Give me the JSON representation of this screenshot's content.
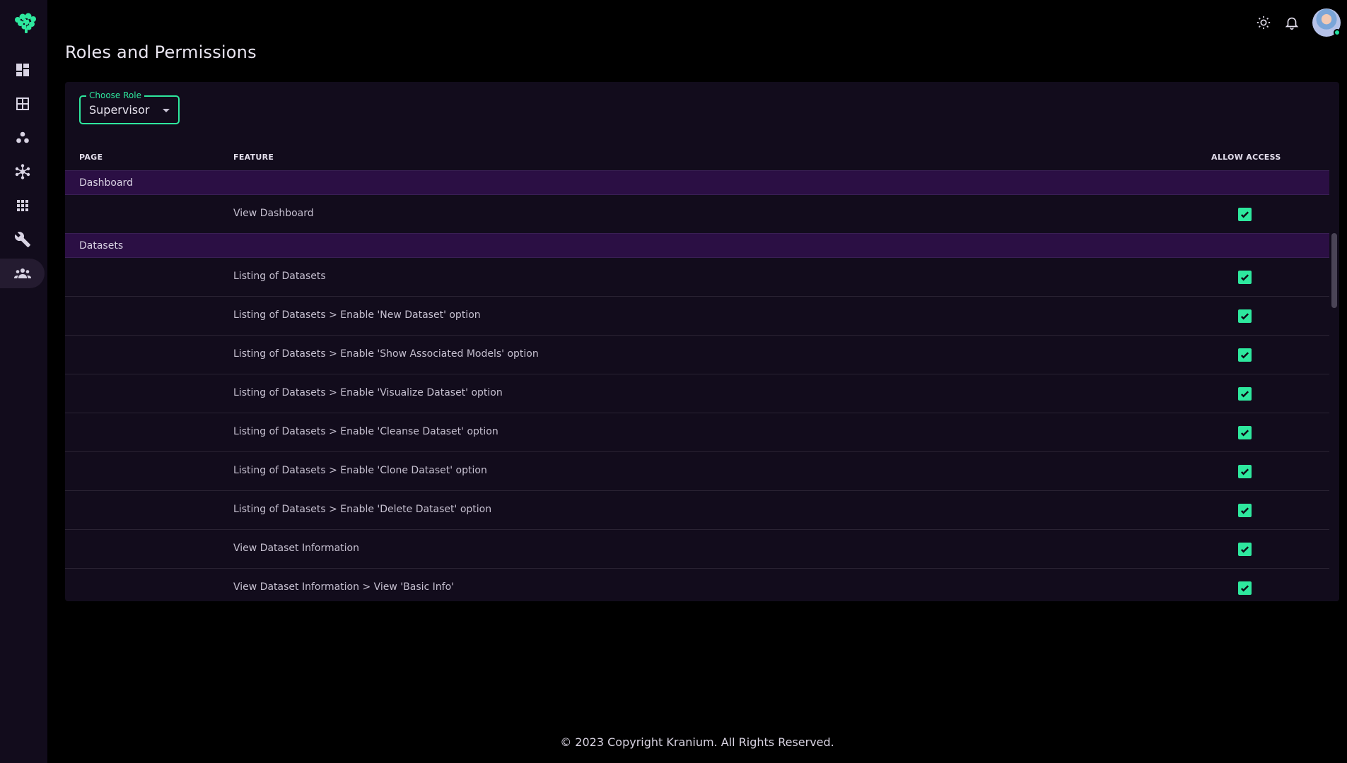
{
  "page": {
    "title": "Roles and Permissions"
  },
  "sidebar": {
    "logo": "kranium-logo-icon",
    "items": [
      {
        "name": "dashboard",
        "icon": "dashboard-icon"
      },
      {
        "name": "datasets",
        "icon": "grid-box-icon"
      },
      {
        "name": "models",
        "icon": "three-dots-icon"
      },
      {
        "name": "network",
        "icon": "hub-icon"
      },
      {
        "name": "apps",
        "icon": "apps-grid-icon"
      },
      {
        "name": "tools",
        "icon": "wrench-icon"
      },
      {
        "name": "users",
        "icon": "group-icon",
        "active": true
      }
    ]
  },
  "topbar": {
    "theme_icon": "sun-icon",
    "notifications_icon": "bell-icon",
    "avatar": "user-avatar"
  },
  "role_select": {
    "legend": "Choose Role",
    "value": "Supervisor"
  },
  "table": {
    "headers": {
      "page": "PAGE",
      "feature": "FEATURE",
      "allow": "ALLOW ACCESS"
    },
    "groups": [
      {
        "page": "Dashboard",
        "features": [
          {
            "label": "View Dashboard",
            "allowed": true
          }
        ]
      },
      {
        "page": "Datasets",
        "features": [
          {
            "label": "Listing of Datasets",
            "allowed": true
          },
          {
            "label": "Listing of Datasets > Enable 'New Dataset' option",
            "allowed": true
          },
          {
            "label": "Listing of Datasets > Enable 'Show Associated Models' option",
            "allowed": true
          },
          {
            "label": "Listing of Datasets > Enable 'Visualize Dataset' option",
            "allowed": true
          },
          {
            "label": "Listing of Datasets > Enable 'Cleanse Dataset' option",
            "allowed": true
          },
          {
            "label": "Listing of Datasets > Enable 'Clone Dataset' option",
            "allowed": true
          },
          {
            "label": "Listing of Datasets > Enable 'Delete Dataset' option",
            "allowed": true
          },
          {
            "label": "View Dataset Information",
            "allowed": true
          },
          {
            "label": "View Dataset Information > View 'Basic Info'",
            "allowed": true
          }
        ]
      }
    ]
  },
  "colors": {
    "accent": "#2ee89e",
    "group_row": "#2b0f44",
    "card": "#120c1c"
  },
  "footer": {
    "text": "© 2023 Copyright Kranium. All Rights Reserved."
  }
}
